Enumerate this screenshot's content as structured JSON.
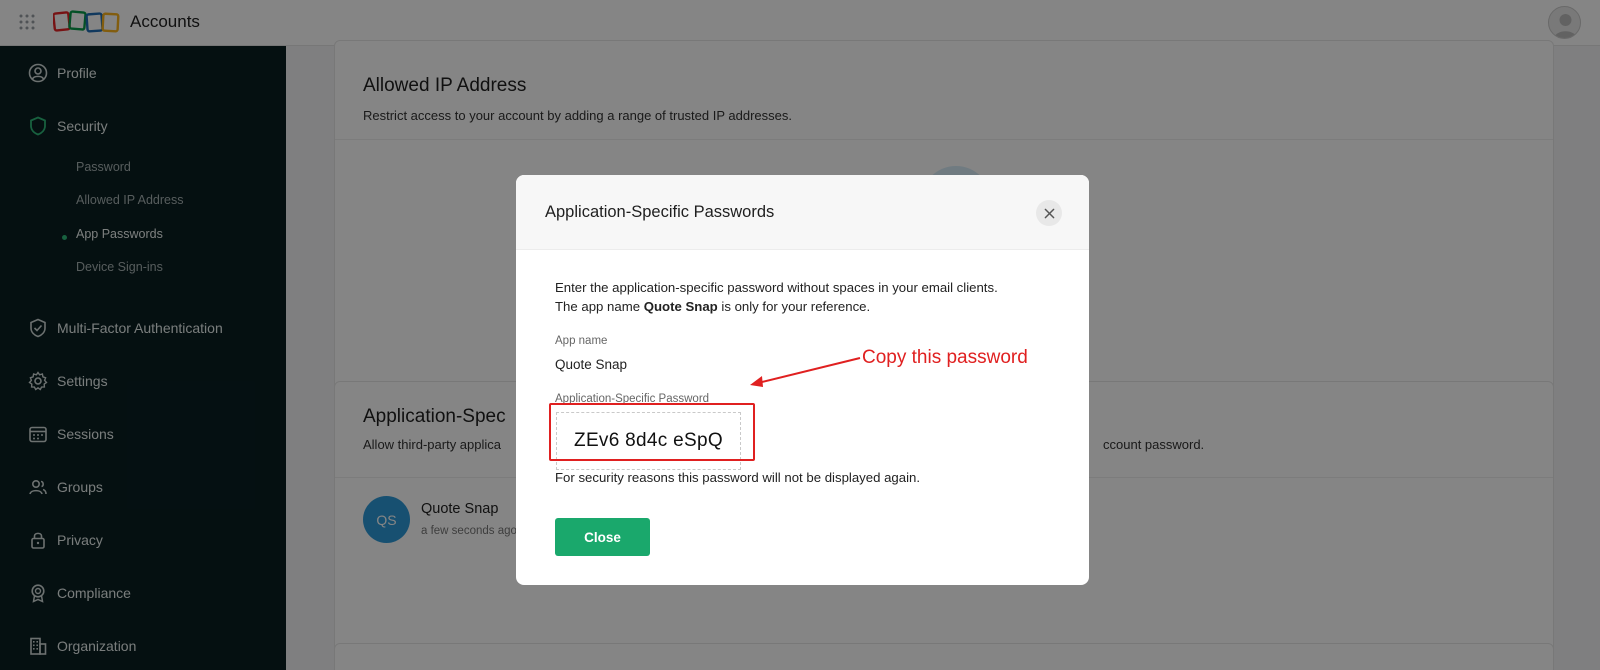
{
  "topbar": {
    "app_title": "Accounts",
    "apps_icon": "apps-grid-icon",
    "user_avatar": "user-avatar-icon"
  },
  "sidebar": {
    "items": [
      {
        "label": "Profile",
        "icon": "profile-icon"
      },
      {
        "label": "Security",
        "icon": "shield-icon",
        "active": true
      },
      {
        "label": "Multi-Factor Authentication",
        "icon": "shield-check-icon"
      },
      {
        "label": "Settings",
        "icon": "gear-icon"
      },
      {
        "label": "Sessions",
        "icon": "calendar-icon"
      },
      {
        "label": "Groups",
        "icon": "users-icon"
      },
      {
        "label": "Privacy",
        "icon": "lock-icon"
      },
      {
        "label": "Compliance",
        "icon": "badge-icon"
      },
      {
        "label": "Organization",
        "icon": "building-icon"
      }
    ],
    "security_subitems": [
      {
        "label": "Password"
      },
      {
        "label": "Allowed IP Address"
      },
      {
        "label": "App Passwords",
        "active": true
      },
      {
        "label": "Device Sign-ins"
      }
    ]
  },
  "main": {
    "allowed_ip": {
      "title": "Allowed IP Address",
      "description": "Restrict access to your account by adding a range of trusted IP addresses."
    },
    "app_passwords": {
      "title": "Application-Spec",
      "description_left": "Allow third-party applica",
      "description_right": "ccount password.",
      "entry": {
        "initials": "QS",
        "name": "Quote Snap",
        "time": "a few seconds ago"
      }
    }
  },
  "modal": {
    "title": "Application-Specific Passwords",
    "close_icon": "close-icon",
    "line1": "Enter the application-specific password without spaces in your email clients.",
    "line2_prefix": "The app name ",
    "line2_app": "Quote Snap",
    "line2_suffix": " is only for your reference.",
    "app_name_label": "App name",
    "app_name_value": "Quote Snap",
    "password_label": "Application-Specific Password",
    "password_value": "ZEv6 8d4c eSpQ",
    "security_note": "For security reasons this password will not be displayed again.",
    "close_button": "Close"
  },
  "annotation": {
    "text": "Copy this password",
    "color": "#e02020"
  },
  "colors": {
    "sidebar_bg": "#0a1f22",
    "accent_green": "#1aa86c",
    "annotation_red": "#e02020"
  }
}
